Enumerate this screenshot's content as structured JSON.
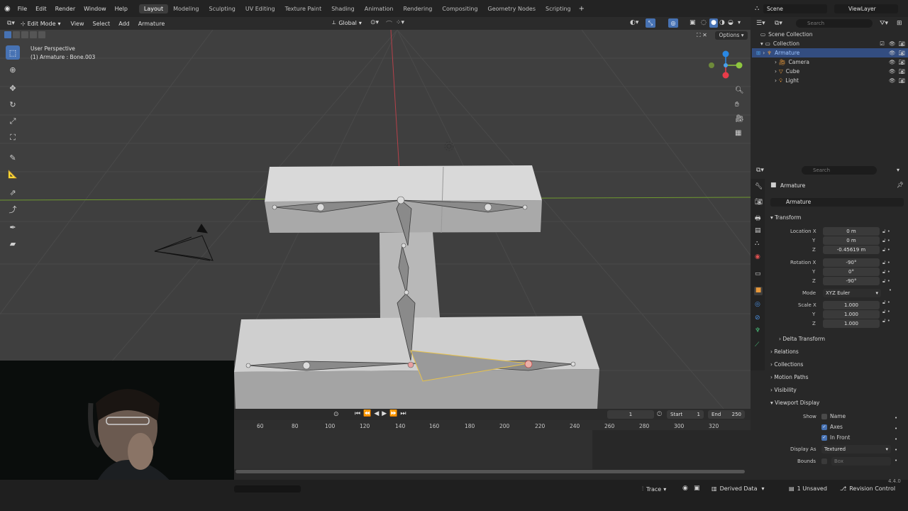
{
  "topbar": {
    "menus": [
      "File",
      "Edit",
      "Render",
      "Window",
      "Help"
    ],
    "workspaces": [
      "Layout",
      "Modeling",
      "Sculpting",
      "UV Editing",
      "Texture Paint",
      "Shading",
      "Animation",
      "Rendering",
      "Compositing",
      "Geometry Nodes",
      "Scripting"
    ],
    "active_workspace": "Layout",
    "scene": "Scene",
    "view_layer": "ViewLayer"
  },
  "viewport_header": {
    "mode": "Edit Mode",
    "menus": [
      "View",
      "Select",
      "Add",
      "Armature"
    ],
    "orientation": "Global",
    "options": "Options"
  },
  "viewport": {
    "perspective": "User Perspective",
    "active_object": "(1) Armature : Bone.003",
    "gizmo_colors": {
      "x": "#e83c4a",
      "y": "#8ec63f",
      "z": "#2a88e3"
    }
  },
  "outliner": {
    "search_placeholder": "Search",
    "root": "Scene Collection",
    "collection": "Collection",
    "items": [
      "Armature",
      "Camera",
      "Cube",
      "Light"
    ],
    "selected": "Armature"
  },
  "properties": {
    "search_placeholder": "Search",
    "object_name": "Armature",
    "data_name": "Armature",
    "transform_label": "Transform",
    "location_label": "Location X",
    "location": [
      "0 m",
      "0 m",
      "-0.45619 m"
    ],
    "rotation_label": "Rotation X",
    "rotation": [
      "-90°",
      "0°",
      "-90°"
    ],
    "mode_label": "Mode",
    "mode_value": "XYZ Euler",
    "scale_label": "Scale X",
    "scale": [
      "1.000",
      "1.000",
      "1.000"
    ],
    "axis_y": "Y",
    "axis_z": "Z",
    "delta_transform": "Delta Transform",
    "panels": [
      "Relations",
      "Collections",
      "Motion Paths",
      "Visibility",
      "Viewport Display"
    ],
    "show_label": "Show",
    "show_options": [
      {
        "label": "Name",
        "checked": false
      },
      {
        "label": "Axes",
        "checked": true
      },
      {
        "label": "In Front",
        "checked": true
      }
    ],
    "display_as_label": "Display As",
    "display_as_value": "Textured",
    "bounds_label": "Bounds",
    "bounds_value": "Box"
  },
  "timeline": {
    "current_frame": "1",
    "start_label": "Start",
    "start": "1",
    "end_label": "End",
    "end": "250",
    "ticks": [
      "60",
      "80",
      "100",
      "120",
      "140",
      "160",
      "180",
      "200",
      "220",
      "240",
      "260",
      "280",
      "300",
      "320"
    ]
  },
  "statusbar": {
    "version": "4.4.0",
    "trace": "Trace",
    "derived_data": "Derived Data",
    "unsaved": "1 Unsaved",
    "revision": "Revision Control"
  }
}
